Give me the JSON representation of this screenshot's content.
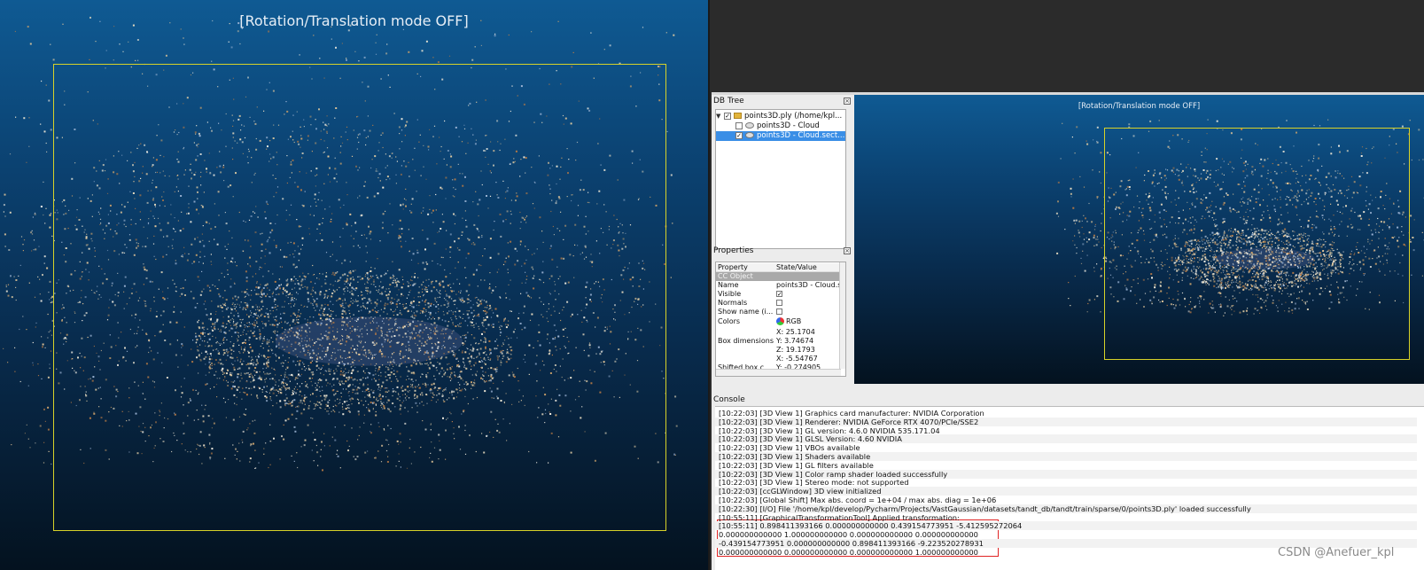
{
  "big_view": {
    "title": "[Rotation/Translation mode OFF]"
  },
  "db_tree": {
    "title": "DB Tree",
    "items": [
      {
        "label": "points3D.ply (/home/kpl..."
      },
      {
        "label": "points3D - Cloud"
      },
      {
        "label": "points3D - Cloud.sect..."
      }
    ]
  },
  "properties": {
    "title": "Properties",
    "header": {
      "property": "Property",
      "value": "State/Value"
    },
    "group": "CC Object",
    "rows": [
      {
        "key": "Name",
        "value": "points3D - Cloud.s"
      },
      {
        "key": "Visible",
        "value": ""
      },
      {
        "key": "Normals",
        "value": ""
      },
      {
        "key": "Show name (i...",
        "value": ""
      },
      {
        "key": "Colors",
        "value": "RGB"
      },
      {
        "key": "Box dimensions",
        "value": ""
      },
      {
        "key": "Shifted box c...",
        "value": ""
      }
    ],
    "box_dimensions": [
      "X: 25.1704",
      "Y: 3.74674",
      "Z: 19.1793"
    ],
    "shifted_box": [
      "X: -5.54767",
      "Y: -0.274905"
    ]
  },
  "small_view": {
    "title": "[Rotation/Translation mode OFF]"
  },
  "console": {
    "title": "Console",
    "lines": [
      "[10:22:03] [3D View 1] Graphics card manufacturer: NVIDIA Corporation",
      "[10:22:03] [3D View 1] Renderer: NVIDIA GeForce RTX 4070/PCIe/SSE2",
      "[10:22:03] [3D View 1] GL version: 4.6.0 NVIDIA 535.171.04",
      "[10:22:03] [3D View 1] GLSL Version: 4.60 NVIDIA",
      "[10:22:03] [3D View 1] VBOs available",
      "[10:22:03] [3D View 1] Shaders available",
      "[10:22:03] [3D View 1] GL filters available",
      "[10:22:03] [3D View 1] Color ramp shader loaded successfully",
      "[10:22:03] [3D View 1] Stereo mode: not supported",
      "[10:22:03] [ccGLWindow] 3D view initialized",
      "[10:22:03] [Global Shift] Max abs. coord = 1e+04 / max abs. diag = 1e+06",
      "[10:22:30] [I/O] File '/home/kpl/develop/Pycharm/Projects/VastGaussian/datasets/tandt_db/tandt/train/sparse/0/points3D.ply' loaded successfully",
      "[10:55:11] [GraphicalTransformationTool] Applied transformation:",
      "[10:55:11] 0.898411393166 0.000000000000 0.439154773951 -5.412595272064",
      "0.000000000000 1.000000000000 0.000000000000 0.000000000000",
      "-0.439154773951 0.000000000000 0.898411393166 -9.223520278931",
      "0.000000000000 0.000000000000 0.000000000000 1.000000000000"
    ]
  },
  "watermark": "CSDN @Anefuer_kpl",
  "colors": {
    "frame": "#d7d229",
    "selection": "#3a8ee6",
    "highlight": "#e02424"
  }
}
